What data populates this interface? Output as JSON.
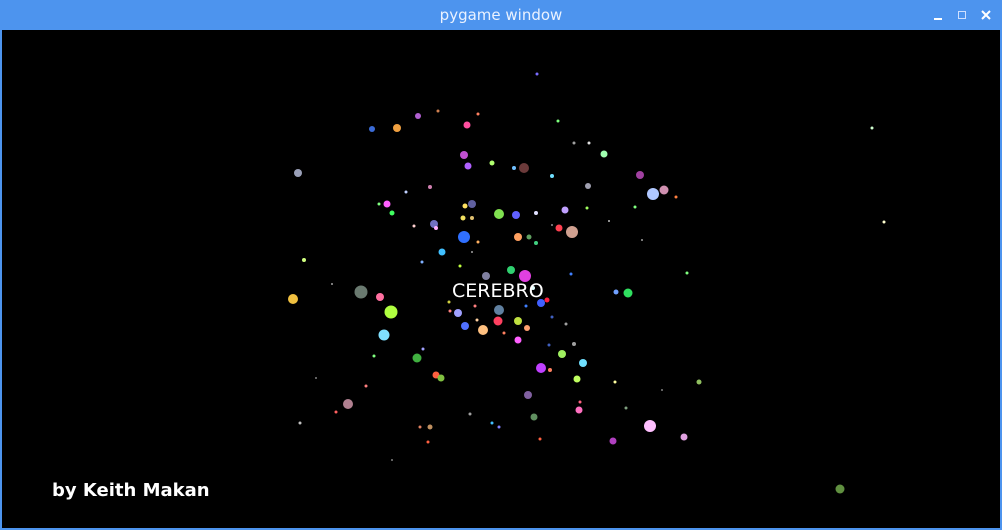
{
  "window": {
    "title": "pygame window",
    "controls": {
      "minimize": "minimize-icon",
      "maximize": "maximize-icon",
      "close": "close-icon"
    },
    "accent_color": "#4d94ee"
  },
  "game": {
    "title": "CEREBRO",
    "credit": "by Keith Makan",
    "background_color": "#000000"
  }
}
